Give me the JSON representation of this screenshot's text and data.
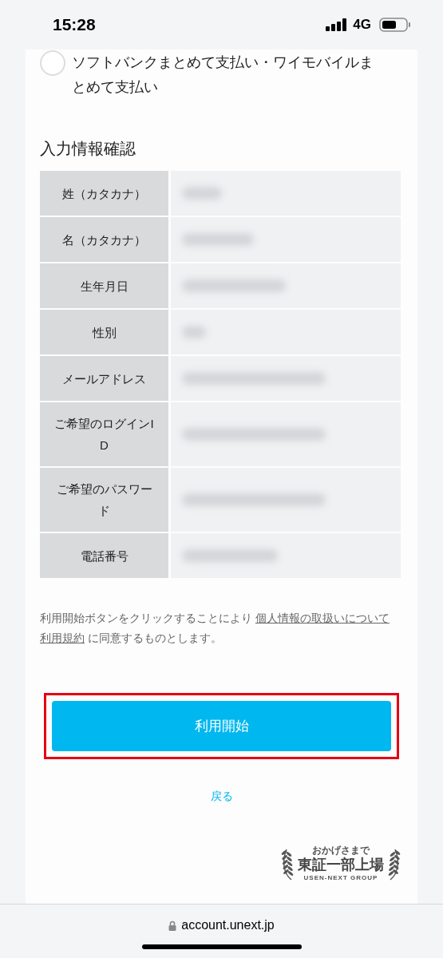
{
  "status_bar": {
    "time": "15:28",
    "network": "4G"
  },
  "payment_option": {
    "label": "ソフトバンクまとめて支払い・ワイモバイルまとめて支払い",
    "checked": false
  },
  "confirm_section": {
    "title": "入力情報確認",
    "rows": [
      {
        "label": "姓（カタカナ）"
      },
      {
        "label": "名（カタカナ）"
      },
      {
        "label": "生年月日"
      },
      {
        "label": "性別"
      },
      {
        "label": "メールアドレス"
      },
      {
        "label": "ご希望のログインID"
      },
      {
        "label": "ご希望のパスワード"
      },
      {
        "label": "電話番号"
      }
    ]
  },
  "notice": {
    "before": "利用開始ボタンをクリックすることにより",
    "links": [
      "個人情報の取扱いについて",
      "利用規約"
    ],
    "after": "に同意するものとします。"
  },
  "start_button": {
    "label": "利用開始",
    "highlighted": true
  },
  "back_link": "戻る",
  "badge": {
    "top": "おかげさまで",
    "main": "東証一部上場",
    "bottom": "USEN-NEXT GROUP"
  },
  "url_bar": {
    "url": "account.unext.jp"
  }
}
